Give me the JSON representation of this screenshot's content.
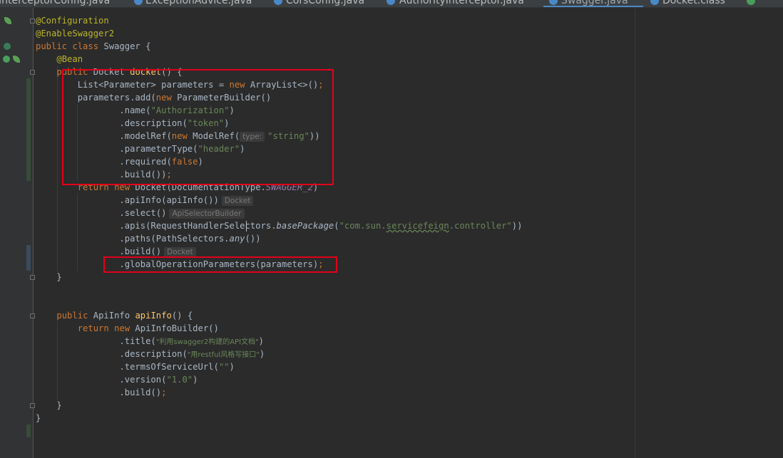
{
  "tabs": [
    {
      "label": "InterceptorConfig.java"
    },
    {
      "label": "ExceptionAdvice.java"
    },
    {
      "label": "CorsConfig.java"
    },
    {
      "label": "AuthorityInterceptor.java"
    },
    {
      "label": "Swagger.java",
      "active": true
    },
    {
      "label": "Docket.class"
    }
  ],
  "code": {
    "annotation_configuration": "@Configuration",
    "annotation_enable_swagger": "@EnableSwagger2",
    "kw_public": "public",
    "kw_class": "class",
    "class_name": "Swagger",
    "brace_open": " {",
    "annotation_bean": "@Bean",
    "kw_public2": "public",
    "type_docket": "Docket",
    "method_docket": "docket",
    "method_docket_sig": "() {",
    "l_list_decl": "List<Parameter> parameters = ",
    "kw_new": "new",
    "l_arraylist": " ArrayList<>()",
    "semi": ";",
    "l_params_add": "parameters.add(",
    "l_parambuilder": " ParameterBuilder()",
    "l_name_call": ".name(",
    "str_authorization": "\"Authorization\"",
    "close_paren": ")",
    "l_desc_call": ".description(",
    "str_token": "\"token\"",
    "l_modelref_call": ".modelRef(",
    "l_modelref_ctor": " ModelRef(",
    "hint_type": "type:",
    "str_string": "\"string\"",
    "close_paren2": "))",
    "l_paramtype_call": ".parameterType(",
    "str_header": "\"header\"",
    "l_required_call": ".required(",
    "kw_false": "false",
    "l_build_call": ".build())",
    "kw_return": "return",
    "l_docket_ctor": " Docket(DocumentationType.",
    "const_swagger2": "SWAGGER_2",
    "l_apiinfo_call": ".apiInfo(apiInfo())",
    "hint_docket": "Docket",
    "l_select_call": ".select()",
    "hint_apiselector": "ApiSelectorBuilder",
    "l_apis_call": ".apis(RequestHandlerSelectors.",
    "m_basepackage": "basePackage",
    "str_pkg_a": "\"com.sun.",
    "str_pkg_b": "servicefeign",
    "str_pkg_c": ".controller\"",
    "l_paths_call": ".paths(PathSelectors.",
    "m_any": "any",
    "l_any_close": "())",
    "l_build2": ".build()",
    "hint_docket2": "Docket",
    "l_global_params": ".globalOperationParameters(parameters)",
    "brace_close": "}",
    "type_apiinfo": "ApiInfo",
    "method_apiinfo": "apiInfo",
    "method_apiinfo_sig": "() {",
    "l_apiinfobuilder": " ApiInfoBuilder()",
    "l_title_call": ".title(",
    "str_title": "\"利用swagger2构建的API文档\"",
    "l_desc2_call": ".description(",
    "str_desc2": "\"用restful风格写接口\"",
    "l_terms_call": ".termsOfServiceUrl(",
    "str_empty": "\"\"",
    "l_version_call": ".version(",
    "str_version": "\"1.0\"",
    "l_build3": ".build()"
  },
  "colors": {
    "background": "#2b2b2b",
    "keyword": "#cc7832",
    "annotation": "#bbb529",
    "string": "#6a8759",
    "method": "#ffc66d",
    "highlight_box": "#e3001b"
  }
}
